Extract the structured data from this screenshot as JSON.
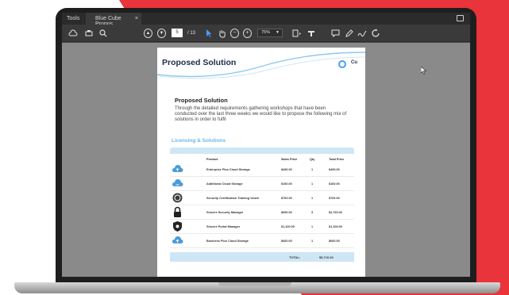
{
  "colors": {
    "brand_red": "#e8343a",
    "accent_blue": "#4a9cff",
    "heading_navy": "#1d2b4a",
    "licensing_blue": "#6fb6e6",
    "table_band": "#cfe6f5"
  },
  "tabbar": {
    "tools_label": "Tools",
    "tab_label": "Blue Cube Propos...",
    "tab_close": "×"
  },
  "toolbar": {
    "page_current": "5",
    "page_total": "/ 13",
    "zoom": "75%"
  },
  "document": {
    "title": "Proposed Solution",
    "logo_text": "Cu",
    "section_heading": "Proposed Solution",
    "section_body": "Through the detailed requirements gathering workshops that have been conducted over the last three weeks we would like to propose the following mix of solutions in order to fulfil",
    "licensing_heading": "Licensing & Solutions",
    "table": {
      "columns": [
        "Product",
        "Sales Price",
        "Qty",
        "Total Price"
      ],
      "rows": [
        {
          "icon": "cloud-upload-icon",
          "product": "Enterprise Plus Cloud Storage",
          "price": "$490.00",
          "qty": "1",
          "total": "$490.00"
        },
        {
          "icon": "cloud-icon",
          "product": "Additional Cloud Storage",
          "price": "$160.00",
          "qty": "1",
          "total": "$160.00"
        },
        {
          "icon": "certificate-icon",
          "product": "Security Certification Training Vouch",
          "price": "$760.00",
          "qty": "1",
          "total": "$760.00"
        },
        {
          "icon": "padlock-icon",
          "product": "Sincere Security Manager",
          "price": "$690.00",
          "qty": "3",
          "total": "$2,760.00"
        },
        {
          "icon": "shield-icon",
          "product": "Sincere Portal Manager",
          "price": "$1,100.00",
          "qty": "1",
          "total": "$1,100.00"
        },
        {
          "icon": "cloud-upload-icon",
          "product": "Business Plus Cloud Storage",
          "price": "$660.00",
          "qty": "1",
          "total": "$660.00"
        }
      ],
      "total_label": "TOTAL:",
      "total_value": "$5,710.00"
    }
  }
}
